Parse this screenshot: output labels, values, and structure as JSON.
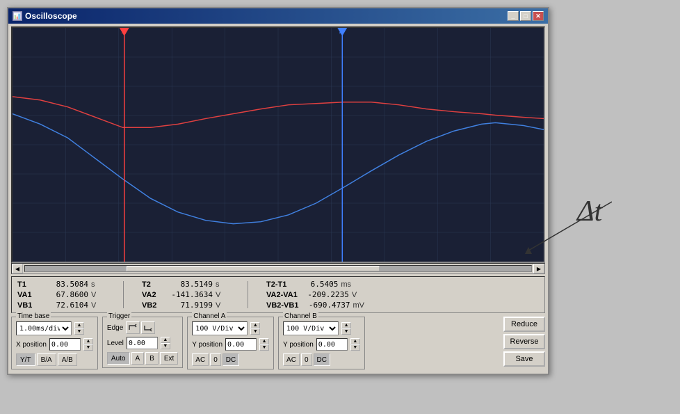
{
  "window": {
    "title": "Oscilloscope",
    "icon": "oscilloscope-icon"
  },
  "measurements": {
    "col1": {
      "t_label": "T1",
      "t_value": "83.5084",
      "t_unit": "s",
      "va_label": "VA1",
      "va_value": "67.8600",
      "va_unit": "V",
      "vb_label": "VB1",
      "vb_value": "72.6104",
      "vb_unit": "V"
    },
    "col2": {
      "t_label": "T2",
      "t_value": "83.5149",
      "t_unit": "s",
      "va_label": "VA2",
      "va_value": "-141.3634",
      "va_unit": "V",
      "vb_label": "VB2",
      "vb_value": "71.9199",
      "vb_unit": "V"
    },
    "col3": {
      "t_label": "T2-T1",
      "t_value": "6.5405",
      "t_unit": "ms",
      "va_label": "VA2-VA1",
      "va_value": "-209.2235",
      "va_unit": "V",
      "vb_label": "VB2-VB1",
      "vb_value": "-690.4737",
      "vb_unit": "mV"
    }
  },
  "controls": {
    "time_base": {
      "label": "Time base",
      "value": "1.00ms/div",
      "x_position_label": "X position",
      "x_position_value": "0.00",
      "mode_buttons": [
        "Y/T",
        "B/A",
        "A/B"
      ]
    },
    "trigger": {
      "label": "Trigger",
      "edge_label": "Edge",
      "level_label": "Level",
      "level_value": "0.00",
      "trigger_buttons": [
        "Auto",
        "A",
        "B",
        "Ext"
      ]
    },
    "channel_a": {
      "label": "Channel A",
      "value": "100 V/Div",
      "y_position_label": "Y position",
      "y_position_value": "0.00",
      "ac_dc_buttons": [
        "AC",
        "0",
        "DC"
      ]
    },
    "channel_b": {
      "label": "Channel B",
      "value": "100 V/Div",
      "y_position_label": "Y position",
      "y_position_value": "0.00",
      "ac_dc_buttons": [
        "AC",
        "0",
        "DC"
      ]
    },
    "buttons": {
      "reduce": "Reduce",
      "reverse": "Reverse",
      "save": "Save"
    }
  },
  "cursors": {
    "cursor1_x_percent": 21,
    "cursor2_x_percent": 62
  },
  "delta_t_label": "Δt"
}
